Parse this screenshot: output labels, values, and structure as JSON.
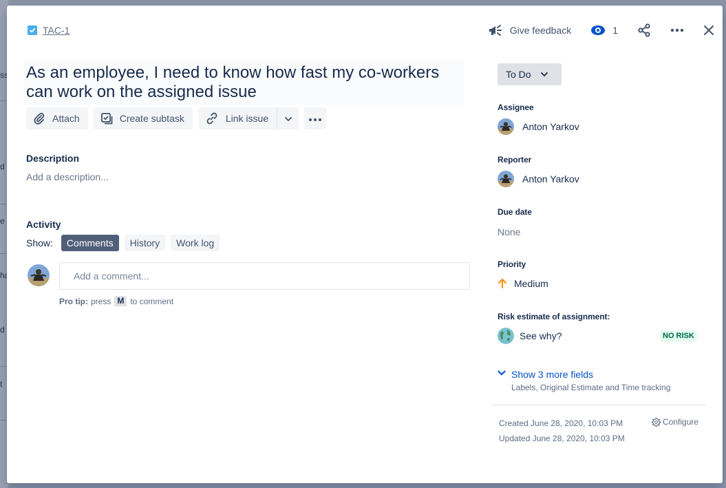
{
  "background": {
    "fragments": [
      "ss",
      "d",
      "e",
      "ha",
      "d",
      "t"
    ]
  },
  "header": {
    "issue_key": "TAC-1",
    "feedback_label": "Give feedback",
    "watch_count": "1"
  },
  "issue": {
    "title": "As an employee, I need to know how fast my co-workers can work on the assigned issue"
  },
  "toolbar": {
    "attach_label": "Attach",
    "subtask_label": "Create subtask",
    "link_label": "Link issue"
  },
  "description": {
    "heading": "Description",
    "placeholder": "Add a description..."
  },
  "activity": {
    "heading": "Activity",
    "show_label": "Show:",
    "tabs": [
      "Comments",
      "History",
      "Work log"
    ],
    "comment_placeholder": "Add a comment...",
    "pro_tip_label": "Pro tip:",
    "pro_tip_press": "press",
    "pro_tip_key": "M",
    "pro_tip_suffix": "to comment"
  },
  "sidebar": {
    "status": "To Do",
    "assignee_label": "Assignee",
    "assignee": "Anton Yarkov",
    "reporter_label": "Reporter",
    "reporter": "Anton Yarkov",
    "due_date_label": "Due date",
    "due_date": "None",
    "priority_label": "Priority",
    "priority": "Medium",
    "risk_label": "Risk estimate of assignment:",
    "risk_link": "See why?",
    "risk_badge": "NO RISK",
    "more_fields_title": "Show 3 more fields",
    "more_fields_sub": "Labels, Original Estimate and Time tracking",
    "created": "Created June 28, 2020, 10:03 PM",
    "updated": "Updated June 28, 2020, 10:03 PM",
    "configure_label": "Configure"
  },
  "colors": {
    "accent": "#0052cc",
    "priority_medium": "#ff8b00",
    "no_risk_bg": "#e3fcef",
    "no_risk_text": "#006644",
    "active_chip": "#505f79"
  }
}
